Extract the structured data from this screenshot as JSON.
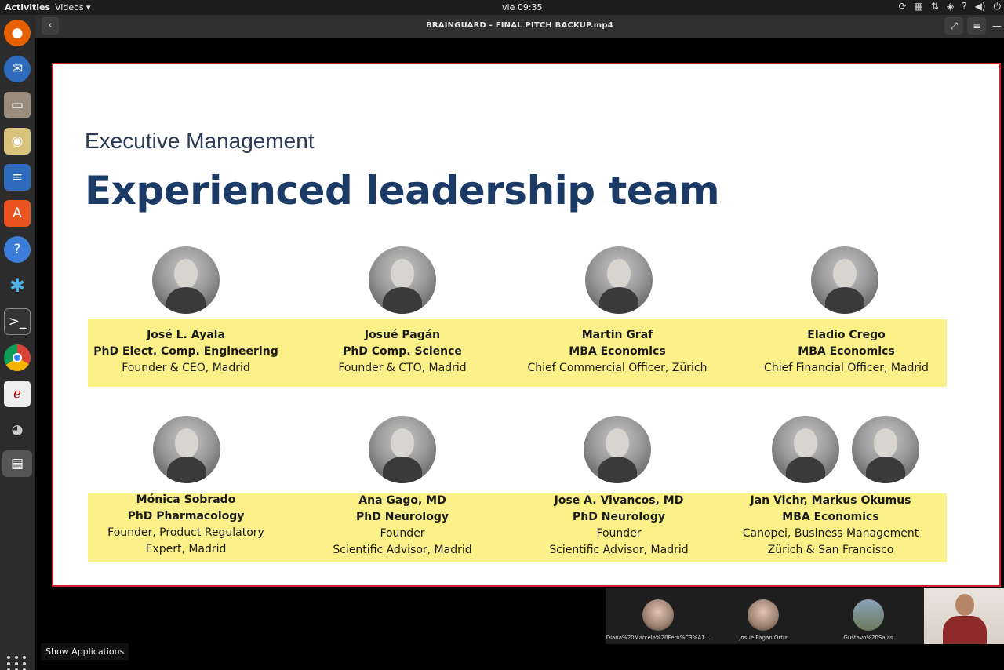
{
  "topbar": {
    "activities": "Activities",
    "app_menu": "Videos ▾",
    "clock": "vie 09:35"
  },
  "dock": {
    "items": [
      "firefox-icon",
      "thunderbird-icon",
      "files-icon",
      "rhythmbox-icon",
      "writer-icon",
      "software-icon",
      "help-icon",
      "bug-icon",
      "terminal-icon",
      "chrome-icon",
      "pdf-icon",
      "gimp-icon",
      "videos-icon"
    ],
    "tooltip": "Show Applications"
  },
  "video": {
    "title": "BRAINGUARD - FINAL PITCH BACKUP.mp4"
  },
  "slide": {
    "subtitle": "Executive Management",
    "title": "Experienced leadership team",
    "row1": [
      {
        "name": "José L. Ayala",
        "degree": "PhD Elect. Comp. Engineering",
        "role": "Founder & CEO, Madrid"
      },
      {
        "name": "Josué Pagán",
        "degree": "PhD Comp. Science",
        "role": "Founder & CTO, Madrid"
      },
      {
        "name": "Martin Graf",
        "degree": "MBA Economics",
        "role": "Chief Commercial Officer, Zürich"
      },
      {
        "name": "Eladio Crego",
        "degree": "MBA Economics",
        "role": "Chief Financial Officer, Madrid"
      }
    ],
    "row2": [
      {
        "name": "Mónica Sobrado",
        "degree": "PhD Pharmacology",
        "role": "Founder, Product Regulatory",
        "role2": "Expert, Madrid"
      },
      {
        "name": "Ana Gago, MD",
        "degree": "PhD Neurology",
        "role": "Founder",
        "role2": "Scientific Advisor, Madrid"
      },
      {
        "name": "Jose A. Vivancos, MD",
        "degree": "PhD Neurology",
        "role": "Founder",
        "role2": "Scientific Advisor, Madrid"
      },
      {
        "name": "Jan Vichr, Markus Okumus",
        "degree": "MBA Economics",
        "role": "Canopei, Business Management",
        "role2": "Zürich & San Francisco"
      }
    ]
  },
  "participants": [
    {
      "label": "Diana%20Marcela%20Fern%C3%A1..."
    },
    {
      "label": "Josué Pagán Ortiz"
    },
    {
      "label": "Gustavo%20Salas"
    }
  ]
}
